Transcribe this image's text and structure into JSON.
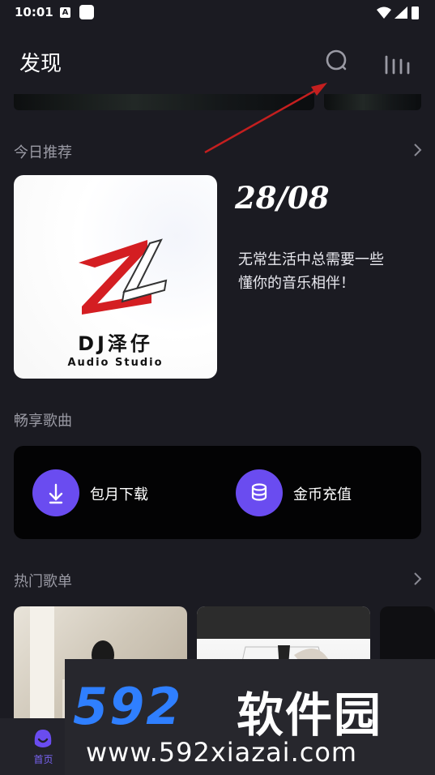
{
  "status_bar": {
    "time": "10:01",
    "notif_letter": "A"
  },
  "header": {
    "title": "发现"
  },
  "today": {
    "section_title": "今日推荐",
    "date": "28/08",
    "text_line1": "无常生活中总需要一些",
    "text_line2": "懂你的音乐相伴！",
    "album_logo": "ZL",
    "album_name": "DJ泽仔",
    "album_sub": "Audio Studio"
  },
  "enjoy": {
    "section_title": "畅享歌曲",
    "items": [
      {
        "label": "包月下载",
        "icon": "download-icon"
      },
      {
        "label": "金币充值",
        "icon": "coins-icon"
      }
    ]
  },
  "hot": {
    "section_title": "热门歌单"
  },
  "bottom_nav": {
    "home_label": "首页"
  },
  "watermark": {
    "logo": "592",
    "name": "软件园",
    "url": "www.592xiazai.com"
  },
  "colors": {
    "accent": "#6a4cf0",
    "background": "#1b1b22",
    "arrow": "#c41f1f"
  }
}
